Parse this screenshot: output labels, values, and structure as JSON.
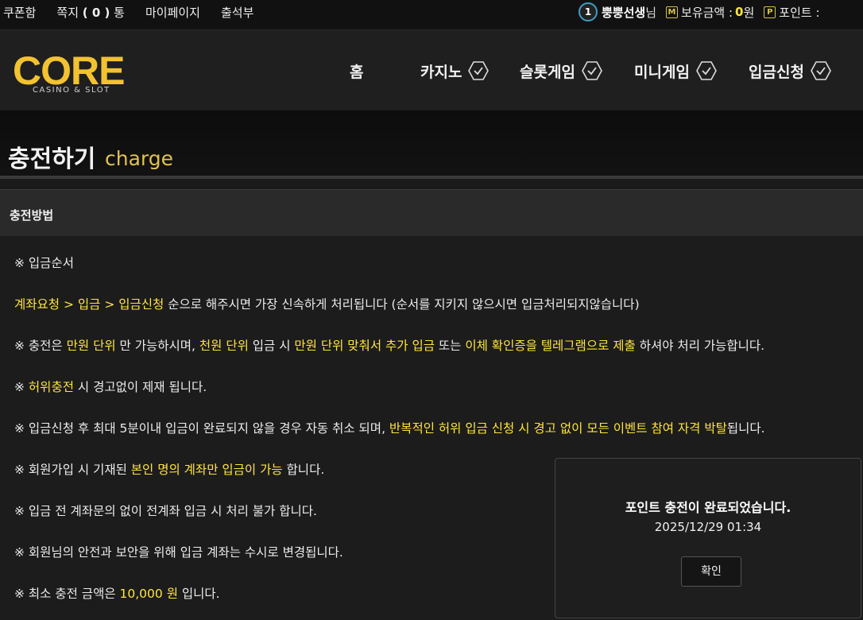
{
  "topbar": {
    "coupon": "쿠폰함",
    "message_prefix": "쪽지",
    "message_count": "( 0 )",
    "message_suffix": "통",
    "mypage": "마이페이지",
    "attendance": "출석부",
    "level": "1",
    "username": "뿡뿡선생",
    "username_suffix": "님",
    "money_icon": "M",
    "money_label": "보유금액 :",
    "money_value": "0",
    "money_unit": "원",
    "point_icon": "P",
    "point_label": "포인트 :"
  },
  "logo": {
    "word": "CORE",
    "sub": "CASINO & SLOT"
  },
  "nav": [
    {
      "label": "홈",
      "has_chevron": false
    },
    {
      "label": "카지노",
      "has_chevron": true
    },
    {
      "label": "슬롯게임",
      "has_chevron": true
    },
    {
      "label": "미니게임",
      "has_chevron": true
    },
    {
      "label": "입금신청",
      "has_chevron": true
    }
  ],
  "page": {
    "title_ko": "충전하기",
    "title_en": "charge"
  },
  "section": {
    "heading": "충전방법",
    "lines": [
      [
        {
          "t": "※ 입금순서",
          "y": false
        }
      ],
      [
        {
          "t": "계좌요청 > 입금 > 입금신청",
          "y": true
        },
        {
          "t": " 순으로 해주시면 가장 신속하게 처리됩니다 (순서를 지키지 않으시면 입금처리되지않습니다)",
          "y": false
        }
      ],
      [
        {
          "t": "※ 충전은 ",
          "y": false
        },
        {
          "t": "만원 단위",
          "y": true
        },
        {
          "t": " 만 가능하시며, ",
          "y": false
        },
        {
          "t": "천원 단위",
          "y": true
        },
        {
          "t": " 입금 시 ",
          "y": false
        },
        {
          "t": "만원 단위 맞춰서 추가 입금",
          "y": true
        },
        {
          "t": " 또는 ",
          "y": false
        },
        {
          "t": "이체 확인증을 텔레그램으로 제출",
          "y": true
        },
        {
          "t": " 하셔야 처리 가능합니다.",
          "y": false
        }
      ],
      [
        {
          "t": "※ ",
          "y": false
        },
        {
          "t": "허위충전",
          "y": true
        },
        {
          "t": " 시 경고없이 제재 됩니다.",
          "y": false
        }
      ],
      [
        {
          "t": "※ 입금신청 후 최대 5분이내 입금이 완료되지 않을 경우 자동 취소 되며, ",
          "y": false
        },
        {
          "t": "반복적인 허위 입금 신청 시 경고 없이 모든 이벤트 참여 자격 박탈",
          "y": true
        },
        {
          "t": "됩니다.",
          "y": false
        }
      ],
      [
        {
          "t": "※ 회원가입 시 기재된 ",
          "y": false
        },
        {
          "t": "본인 명의 계좌만 입금이 가능",
          "y": true
        },
        {
          "t": " 합니다.",
          "y": false
        }
      ],
      [
        {
          "t": "※ 입금 전 계좌문의 없이 전계좌 입금 시 처리 불가 합니다.",
          "y": false
        }
      ],
      [
        {
          "t": "※ 회원님의 안전과 보안을 위해 입금 계좌는 수시로 변경됩니다.",
          "y": false
        }
      ],
      [
        {
          "t": "※ 최소 충전 금액은 ",
          "y": false
        },
        {
          "t": "10,000 원",
          "y": true
        },
        {
          "t": " 입니다.",
          "y": false
        }
      ]
    ]
  },
  "modal": {
    "message": "포인트 충전이 완료되었습니다.",
    "timestamp": "2025/12/29 01:34",
    "confirm": "확인"
  },
  "colors": {
    "accent_yellow": "#ffe53b",
    "logo_gold": "#f2c230",
    "level_ring": "#3aa0c8"
  }
}
